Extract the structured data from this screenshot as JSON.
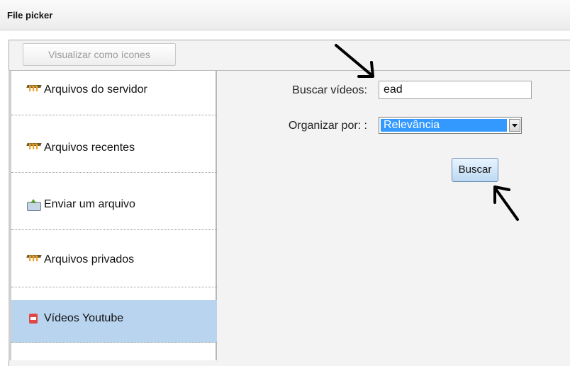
{
  "window": {
    "title": "File picker"
  },
  "toolbar": {
    "view_as_icons_label": "Visualizar como ícones"
  },
  "sidebar": {
    "items": [
      {
        "label": "Arquivos do servidor",
        "icon": "moodle-icon",
        "active": false
      },
      {
        "label": "Arquivos recentes",
        "icon": "moodle-icon",
        "active": false
      },
      {
        "label": "Enviar um arquivo",
        "icon": "upload-icon",
        "active": false
      },
      {
        "label": "Arquivos privados",
        "icon": "moodle-icon",
        "active": false
      },
      {
        "label": "Vídeos Youtube",
        "icon": "youtube-icon",
        "active": true
      }
    ]
  },
  "search_form": {
    "search_label": "Buscar vídeos:",
    "search_value": "ead",
    "sort_label": "Organizar por: :",
    "sort_selected": "Relevância",
    "submit_label": "Buscar"
  },
  "colors": {
    "active_item_bg": "#b8d4ef",
    "select_highlight": "#3399ff"
  }
}
